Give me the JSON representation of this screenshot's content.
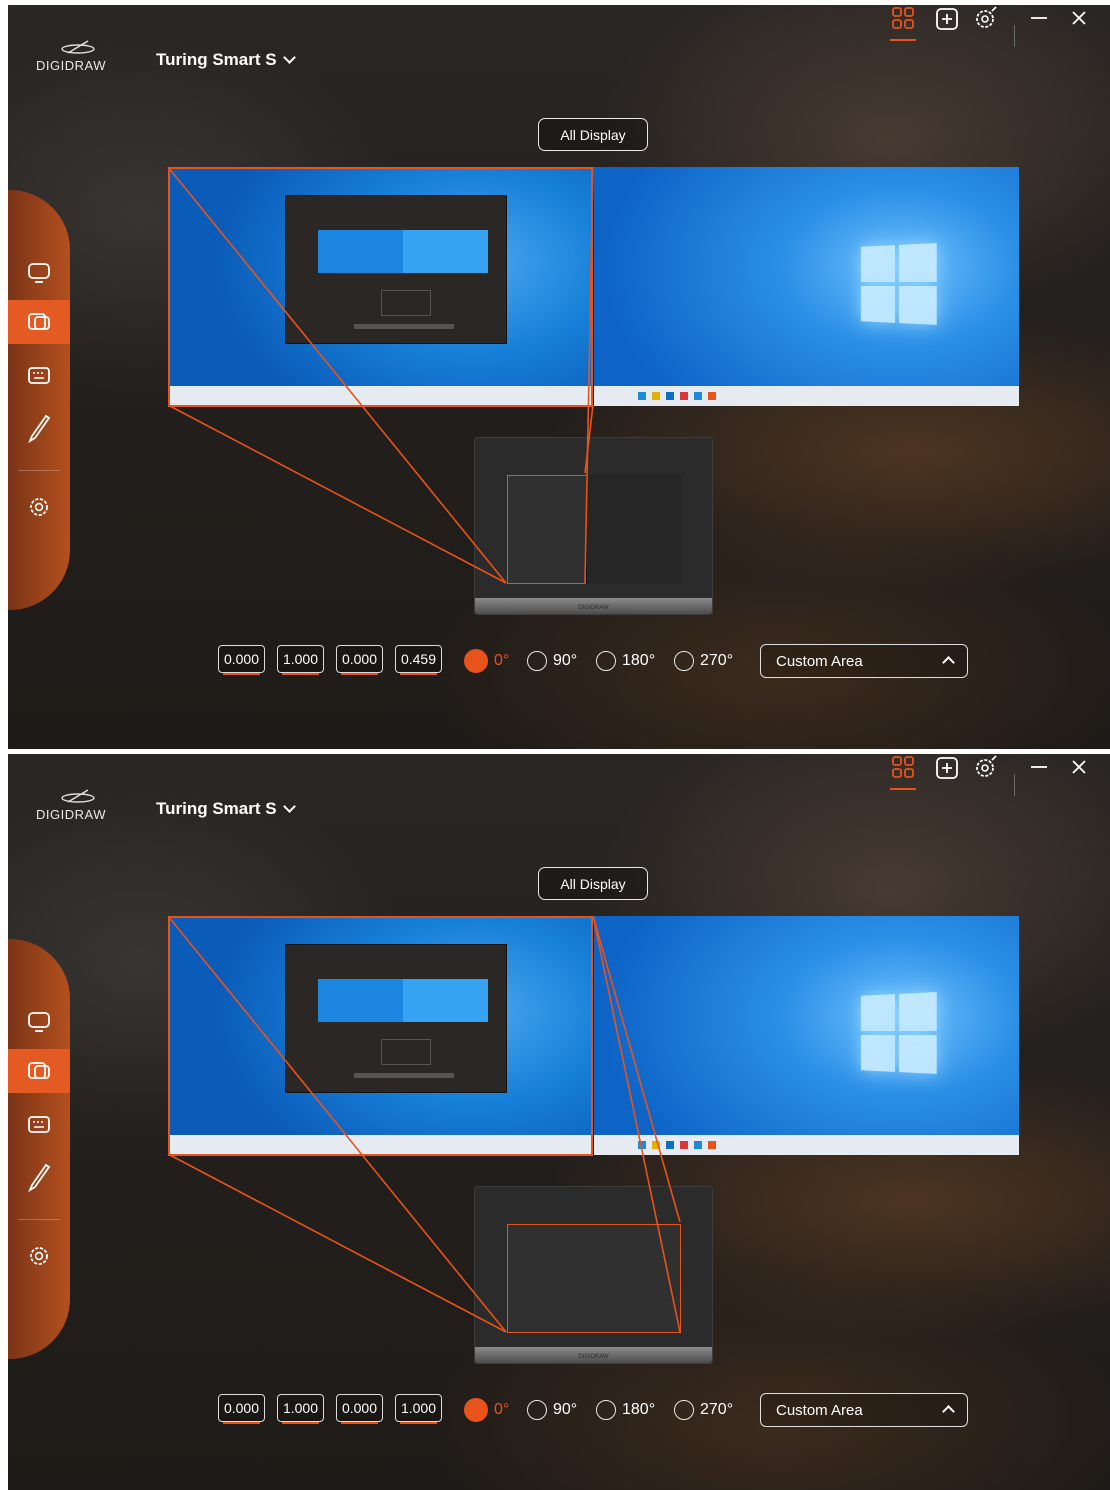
{
  "app": {
    "logo_text": "DIGIDRAW",
    "device_name": "Turing Smart S"
  },
  "toolbar": {
    "icons": [
      "grid-icon",
      "add-box-icon",
      "settings-badge-icon",
      "minimize-icon",
      "close-icon"
    ]
  },
  "sidebar": {
    "items": [
      "monitor-icon",
      "dual-screen-icon",
      "keyboard-icon",
      "pen-icon",
      "gear-icon"
    ],
    "active": "dual-screen-icon"
  },
  "display": {
    "all_display_label": "All Display"
  },
  "rotation": {
    "options": [
      "0°",
      "90°",
      "180°",
      "270°"
    ],
    "selected": "0°"
  },
  "area_mode": "Custom Area",
  "colors": {
    "accent": "#e8531c",
    "background": "#231f1c"
  },
  "panels": [
    {
      "values": [
        "0.000",
        "1.000",
        "0.000",
        "0.459"
      ]
    },
    {
      "values": [
        "0.000",
        "1.000",
        "0.000",
        "1.000"
      ]
    }
  ]
}
